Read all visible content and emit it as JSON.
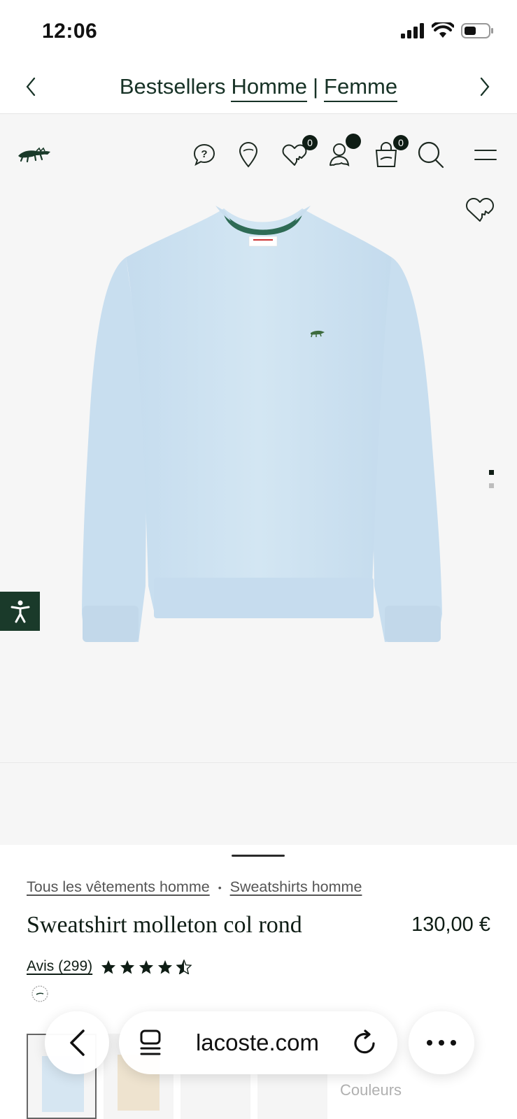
{
  "status_bar": {
    "time": "12:06"
  },
  "banner": {
    "prefix": "Bestsellers",
    "link_men": "Homme",
    "separator": "|",
    "link_women": "Femme"
  },
  "header": {
    "wishlist_count": "0",
    "cart_count": "0"
  },
  "product": {
    "breadcrumb": [
      "Tous les vêtements homme",
      "Sweatshirts homme"
    ],
    "breadcrumb_sep": "•",
    "name": "Sweatshirt molleton col rond",
    "price": "130,00 €",
    "reviews_label": "Avis (299)",
    "rating": 4.5,
    "colors_label": "Couleurs"
  },
  "browser": {
    "url": "lacoste.com"
  },
  "colors": {
    "brand_green": "#1a3a2a",
    "sweatshirt": "#cfe3f1"
  }
}
